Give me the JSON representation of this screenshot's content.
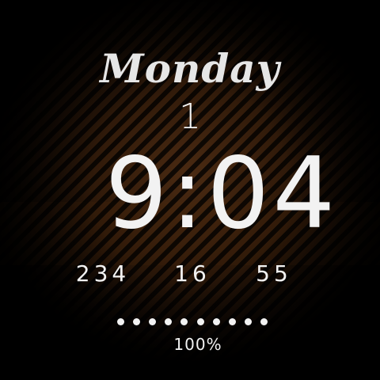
{
  "watchface": {
    "day": "Monday",
    "date": "1",
    "time": "9:04",
    "stats": [
      "234",
      "16",
      "55"
    ],
    "battery": {
      "label": "100%",
      "level_percent": 100,
      "dot_count": 10
    },
    "colors": {
      "text": "#f2f2f2",
      "background_glow": "#4a2a12",
      "background": "#000000"
    }
  }
}
